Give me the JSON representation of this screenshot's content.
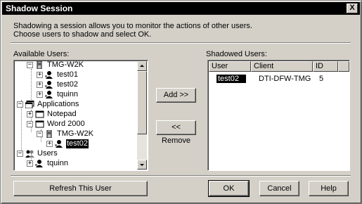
{
  "window": {
    "title": "Shadow Session",
    "close_glyph": "X"
  },
  "description": {
    "line1": "Shadowing a session allows you to monitor the actions of other users.",
    "line2": "Choose users to shadow and select OK."
  },
  "available": {
    "label": "Available Users:",
    "tree": [
      {
        "label": "TMG-W2K",
        "expander": "−",
        "icon": "computer-icon"
      },
      {
        "label": "test01",
        "expander": "+",
        "icon": "user-icon"
      },
      {
        "label": "test02",
        "expander": "+",
        "icon": "user-icon"
      },
      {
        "label": "tquinn",
        "expander": "+",
        "icon": "user-icon"
      },
      {
        "label": "Applications",
        "expander": "−",
        "icon": "applications-icon"
      },
      {
        "label": "Notepad",
        "expander": "+",
        "icon": "application-window-icon"
      },
      {
        "label": "Word 2000",
        "expander": "−",
        "icon": "application-window-icon"
      },
      {
        "label": "TMG-W2K",
        "expander": "−",
        "icon": "computer-icon"
      },
      {
        "label": "test02",
        "expander": "+",
        "icon": "user-icon",
        "selected": true
      },
      {
        "label": "Users",
        "expander": "−",
        "icon": "users-group-icon"
      },
      {
        "label": "tquinn",
        "expander": "+",
        "icon": "user-icon"
      }
    ]
  },
  "buttons": {
    "add": "Add >>",
    "remove": "<< Remove",
    "refresh": "Refresh This User",
    "ok": "OK",
    "cancel": "Cancel",
    "help": "Help"
  },
  "shadowed": {
    "label": "Shadowed Users:",
    "columns": [
      "User",
      "Client",
      "ID"
    ],
    "rows": [
      {
        "user": "test02",
        "client": "DTI-DFW-TMG",
        "id": "5"
      }
    ]
  }
}
